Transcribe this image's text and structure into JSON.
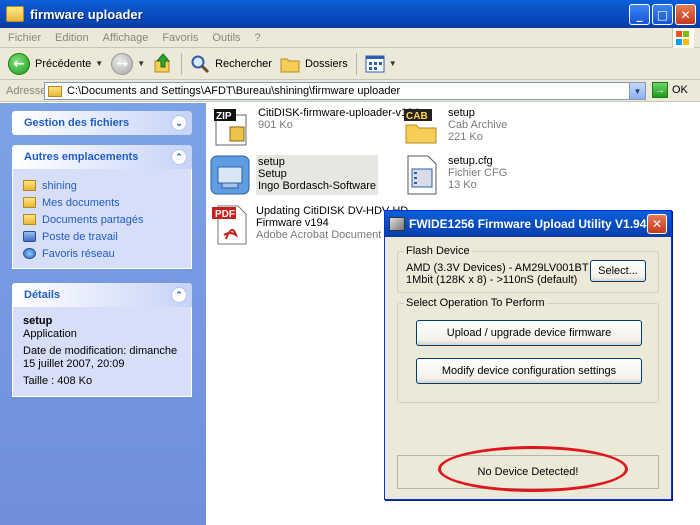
{
  "window": {
    "title": "firmware uploader",
    "minimize": "_",
    "maximize": "□",
    "close": "✕"
  },
  "menu": [
    "Fichier",
    "Edition",
    "Affichage",
    "Favoris",
    "Outils",
    "?"
  ],
  "toolbar": {
    "back": "Précédente",
    "search": "Rechercher",
    "folders": "Dossiers"
  },
  "address": {
    "label": "Adresse",
    "path": "C:\\Documents and Settings\\AFDT\\Bureau\\shining\\firmware uploader",
    "go": "OK"
  },
  "left": {
    "tasks": {
      "title": "Gestion des fichiers"
    },
    "places": {
      "title": "Autres emplacements",
      "items": [
        "shining",
        "Mes documents",
        "Documents partagés",
        "Poste de travail",
        "Favoris réseau"
      ]
    },
    "details": {
      "title": "Détails",
      "name": "setup",
      "type": "Application",
      "modified": "Date de modification: dimanche 15 juillet 2007, 20:09",
      "size": "Taille : 408 Ko"
    }
  },
  "files": [
    {
      "name": "CitiDISK-firmware-uploader-v194",
      "line2": "901 Ko",
      "line3": "",
      "icon": "zip-icon",
      "icon_label": "ZIP"
    },
    {
      "name": "setup",
      "line2": "Cab Archive",
      "line3": "221 Ko",
      "icon": "cab-icon",
      "icon_label": "CAB"
    },
    {
      "name": "setup",
      "line2": "Setup",
      "line3": "Ingo Bordasch-Software",
      "icon": "setup-icon",
      "icon_label": ""
    },
    {
      "name": "setup.cfg",
      "line2": "Fichier CFG",
      "line3": "13 Ko",
      "icon": "cfg-icon",
      "icon_label": ""
    },
    {
      "name": "Updating CitiDISK DV-HDV-HD",
      "line2": "Firmware v194",
      "line3": "Adobe Acrobat Document",
      "icon": "pdf-icon",
      "icon_label": "PDF"
    }
  ],
  "dialog": {
    "title": "FWIDE1256 Firmware Upload Utility V1.94",
    "close": "✕",
    "flash_group": "Flash Device",
    "flash_line1": "AMD (3.3V Devices) - AM29LV001BT",
    "flash_line2": "1Mbit (128K x 8) - >110nS (default)",
    "select_btn": "Select...",
    "op_group": "Select Operation To Perform",
    "upload_btn": "Upload / upgrade device firmware",
    "modify_btn": "Modify device configuration settings",
    "status": "No Device Detected!"
  },
  "colors": {
    "xp_blue": "#0a4fc4",
    "task_pane": "#7ba2e7",
    "highlight_ellipse": "#e0151a"
  }
}
